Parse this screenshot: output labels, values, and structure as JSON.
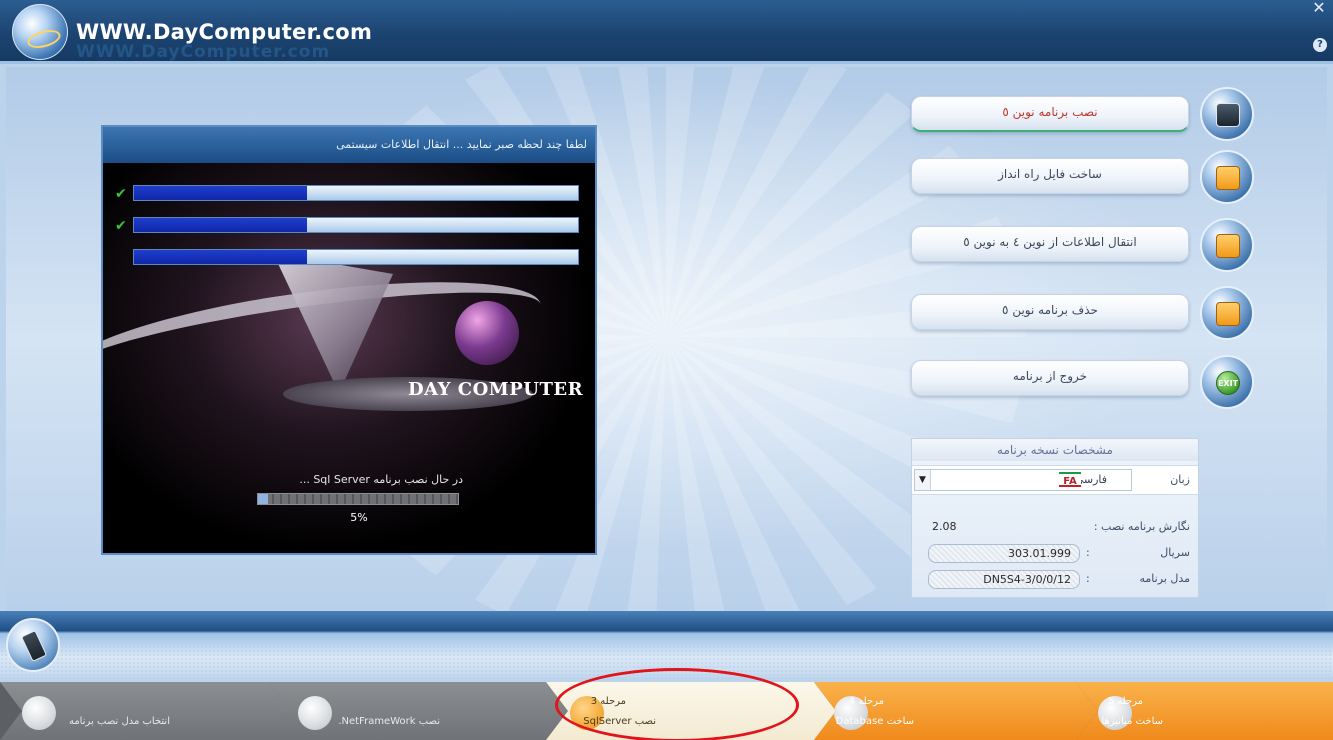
{
  "header": {
    "site_name": "WWW.DayComputer.com",
    "close_glyph": "✕",
    "help_glyph": "?"
  },
  "installer": {
    "title": "لطفا چند لحظه صبر نمایید ...   انتقال اطلاعات سیستمی",
    "brand": "DAY  COMPUTER",
    "checks": [
      "✔",
      "✔"
    ],
    "progress_bars": [
      0.39,
      0.39,
      0.39
    ],
    "status": "در حال نصب برنامه Sql Server ...",
    "percent_label": "5%",
    "percent_value": 0.05
  },
  "menu": {
    "items": [
      {
        "label": "نصب برنامه نوین ٥",
        "icon": "monitor-icon",
        "state": "active"
      },
      {
        "label": "ساخت فایل راه انداز",
        "icon": "lock-icon",
        "state": "normal"
      },
      {
        "label": "انتقال اطلاعات از نوین ٤ به نوین ٥",
        "icon": "lock-icon",
        "state": "normal"
      },
      {
        "label": "حذف برنامه نوین ٥",
        "icon": "lock-icon",
        "state": "normal"
      },
      {
        "label": "خروج از برنامه",
        "icon": "exit-icon",
        "state": "normal",
        "icon_text": "EXIT"
      }
    ]
  },
  "spec": {
    "title": "مشخصات نسخه برنامه",
    "language_label": "زبان",
    "language_value": "فارسی",
    "language_flag": "FA",
    "dropdown_arrow": "▼",
    "version_label": "نگارش برنامه نصب :",
    "version_value": "2.08",
    "serial_label": "سریال",
    "serial_value": "303.01.999",
    "model_label": "مدل برنامه",
    "model_value": "DN5S4-3/0/0/12",
    "colon": ":"
  },
  "steps": [
    {
      "num": "",
      "label": "انتخاب مدل نصب برنامه",
      "state": "done"
    },
    {
      "num": "",
      "label": "نصب NetFrameWork.",
      "state": "done"
    },
    {
      "num": "مرحله 3",
      "label": "نصب SqlServer",
      "state": "current"
    },
    {
      "num": "مرحله 4",
      "label": "ساخت Database",
      "state": "todo"
    },
    {
      "num": "مرحله 5",
      "label": "ساخت میانبرها",
      "state": "todo"
    }
  ],
  "colors": {
    "accent_blue": "#1c4471",
    "step_todo": "#f08a1c",
    "step_done": "#7a7e82",
    "highlight": "#e0141b",
    "progress_fill": "#1026a8"
  }
}
